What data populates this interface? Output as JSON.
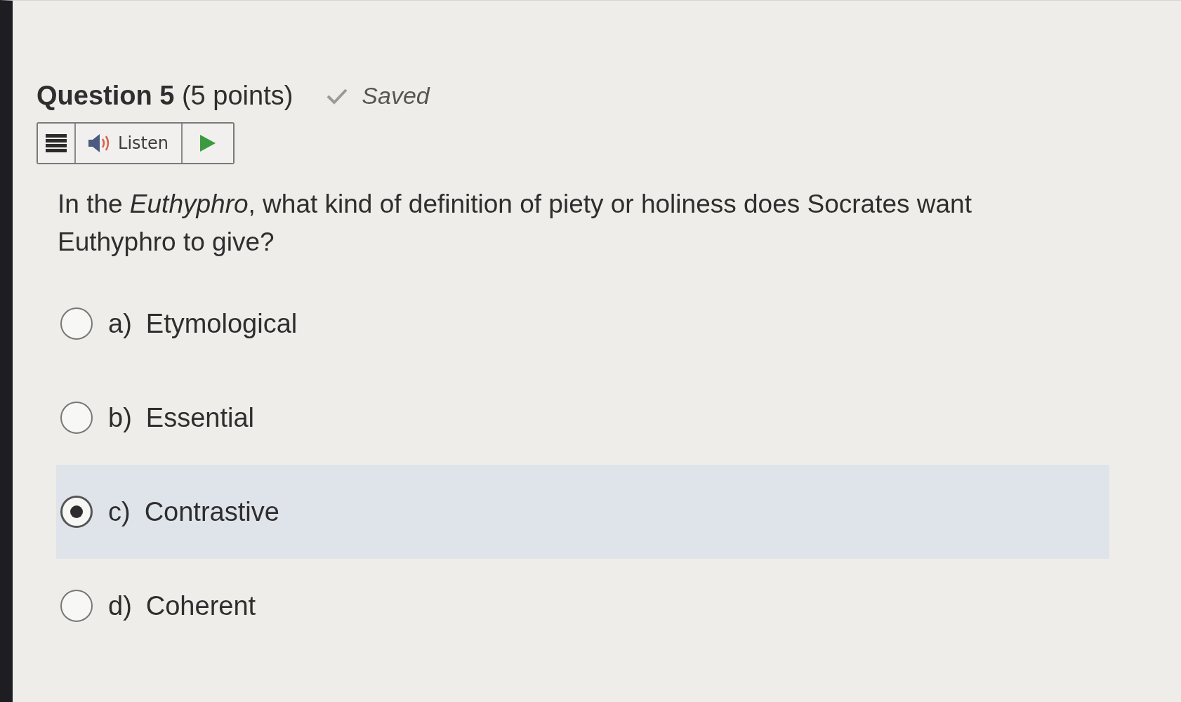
{
  "question": {
    "title": "Question 5",
    "points": "(5 points)",
    "status": "Saved"
  },
  "toolbar": {
    "listen_label": "Listen"
  },
  "prompt": "In the *Euthyphro*, what kind of definition of piety or holiness does Socrates want Euthyphro to give?",
  "options": [
    {
      "letter": "a)",
      "text": "Etymological",
      "selected": false
    },
    {
      "letter": "b)",
      "text": "Essential",
      "selected": false
    },
    {
      "letter": "c)",
      "text": "Contrastive",
      "selected": true
    },
    {
      "letter": "d)",
      "text": "Coherent",
      "selected": false
    }
  ]
}
